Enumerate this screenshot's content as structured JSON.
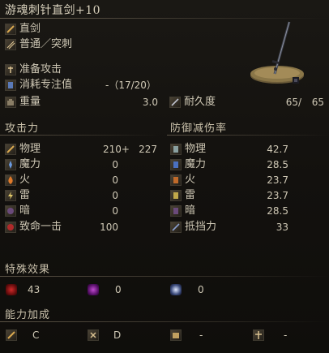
{
  "title": "游魂刺针直剑+10",
  "weapon": {
    "category": "直剑",
    "attack_type": "普通／突刺",
    "skill": "准备攻击",
    "fp_label": "消耗专注值",
    "fp_value": "-（17/20）",
    "weight_label": "重量",
    "weight_value": "3.0",
    "durability_label": "耐久度",
    "durability_current": "65/",
    "durability_max": "65"
  },
  "attack": {
    "header": "攻击力",
    "rows": [
      {
        "label": "物理",
        "base": "210+",
        "bonus": "227",
        "icon": "physical-icon"
      },
      {
        "label": "魔力",
        "base": "0",
        "icon": "magic-icon"
      },
      {
        "label": "火",
        "base": "0",
        "icon": "fire-icon"
      },
      {
        "label": "雷",
        "base": "0",
        "icon": "lightning-icon"
      },
      {
        "label": "暗",
        "base": "0",
        "icon": "dark-icon"
      },
      {
        "label": "致命一击",
        "base": "100",
        "icon": "critical-icon"
      }
    ]
  },
  "guard": {
    "header": "防御减伤率",
    "rows": [
      {
        "label": "物理",
        "value": "42.7"
      },
      {
        "label": "魔力",
        "value": "28.5"
      },
      {
        "label": "火",
        "value": "23.7"
      },
      {
        "label": "雷",
        "value": "23.7"
      },
      {
        "label": "暗",
        "value": "28.5"
      },
      {
        "label": "抵挡力",
        "value": "33"
      }
    ]
  },
  "effects": {
    "header": "特殊效果",
    "items": [
      {
        "value": "43",
        "icon": "bleed-icon"
      },
      {
        "value": "0",
        "icon": "poison-icon"
      },
      {
        "value": "0",
        "icon": "frost-icon"
      }
    ]
  },
  "scaling": {
    "header": "能力加成",
    "items": [
      {
        "grade": "C",
        "icon": "strength-icon"
      },
      {
        "grade": "D",
        "icon": "dexterity-icon"
      },
      {
        "grade": "-",
        "icon": "intelligence-icon"
      },
      {
        "grade": "-",
        "icon": "faith-icon"
      }
    ]
  }
}
